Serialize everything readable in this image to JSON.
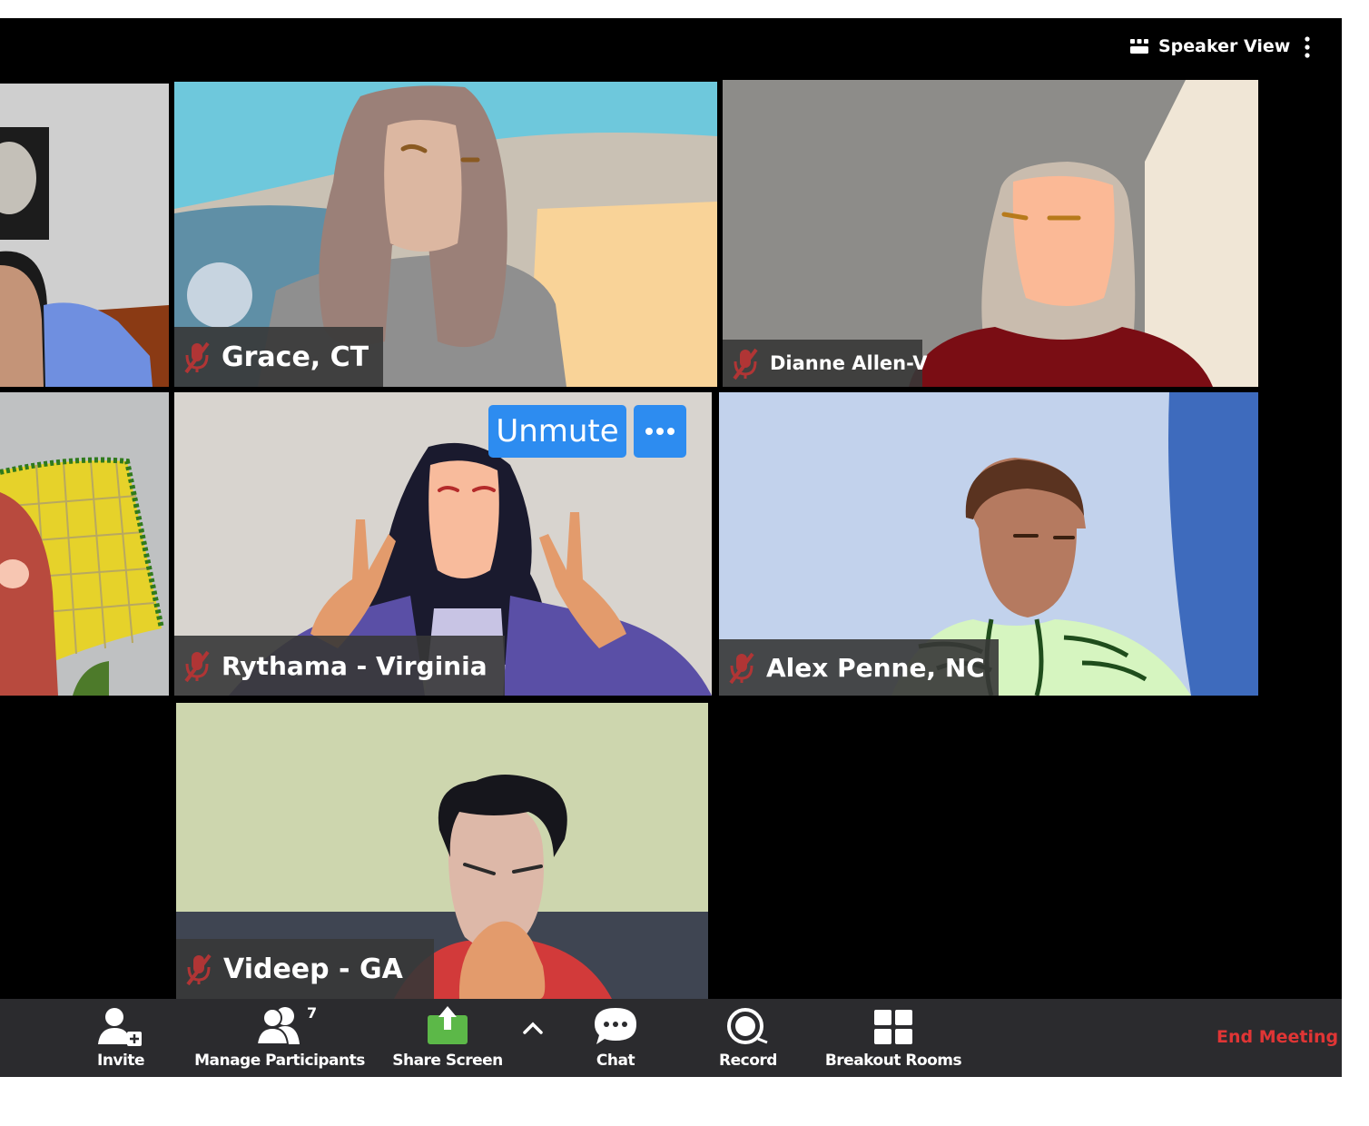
{
  "header": {
    "view_label": "Speaker View",
    "view_icon": "grid-icon",
    "more_icon": "vertical-ellipsis-icon"
  },
  "participants": [
    {
      "name": "",
      "muted": false
    },
    {
      "name": "Grace, CT",
      "muted": true
    },
    {
      "name": "Dianne Allen-V",
      "muted": true
    },
    {
      "name": "",
      "muted": false
    },
    {
      "name": "Rythama - Virginia",
      "muted": true
    },
    {
      "name": "Alex Penne, NC",
      "muted": true
    },
    {
      "name": "Videep - GA",
      "muted": true
    }
  ],
  "hover_controls": {
    "unmute_label": "Unmute",
    "more_icon": "horizontal-ellipsis-icon"
  },
  "toolbar": {
    "invite_label": "Invite",
    "manage_participants_label": "Manage Participants",
    "participant_count": "7",
    "share_screen_label": "Share Screen",
    "chat_label": "Chat",
    "record_label": "Record",
    "breakout_rooms_label": "Breakout Rooms",
    "end_meeting_label": "End Meeting"
  },
  "colors": {
    "toolbar_bg": "#2b2b2e",
    "unmute_blue": "#2d8cf0",
    "share_green": "#5cb848",
    "end_meeting_red": "#e03535",
    "muted_icon_red": "#b03535"
  }
}
